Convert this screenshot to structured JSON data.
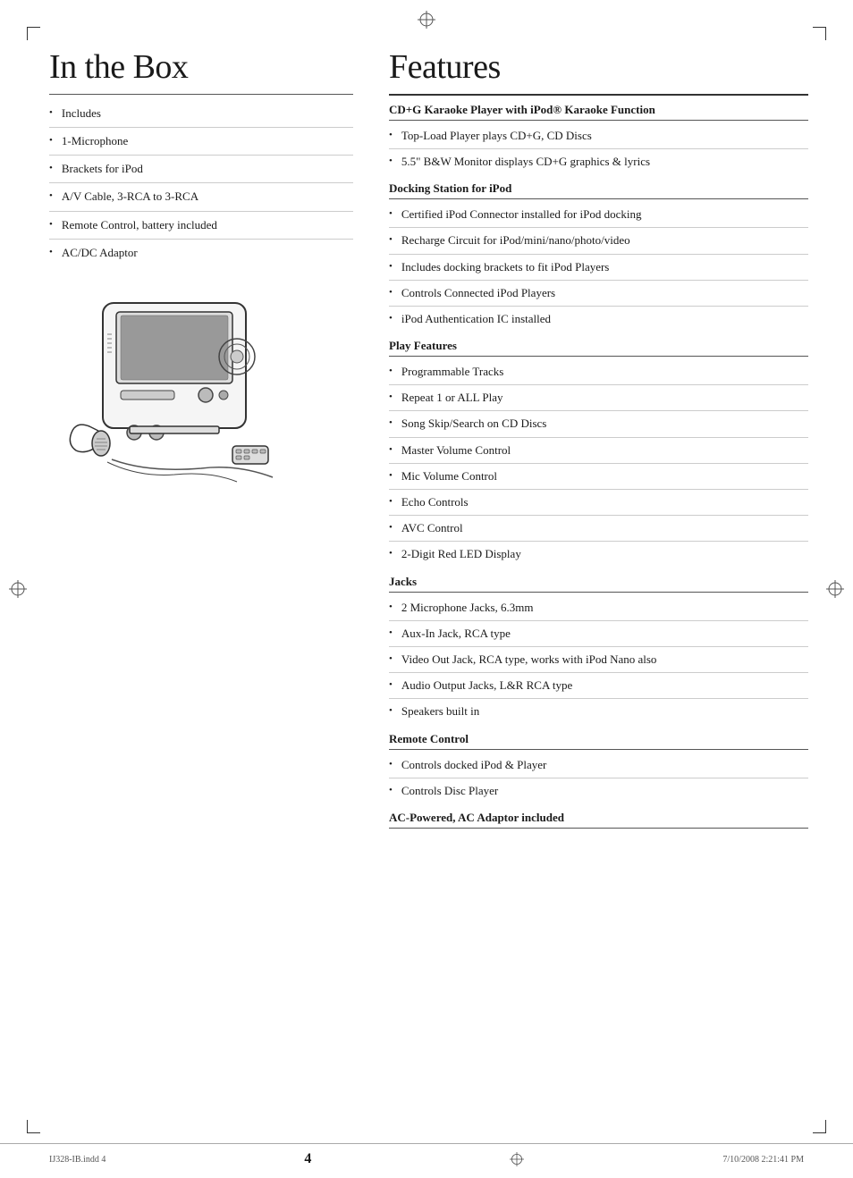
{
  "page": {
    "number": "4",
    "footer_left": "IJ328-IB.indd   4",
    "footer_right": "7/10/2008   2:21:41 PM"
  },
  "left": {
    "title": "In the Box",
    "items": [
      "Includes",
      "1-Microphone",
      "Brackets for iPod",
      "A/V Cable, 3-RCA to 3-RCA",
      "Remote Control, battery included",
      "AC/DC Adaptor"
    ]
  },
  "right": {
    "title": "Features",
    "sections": [
      {
        "header": "CD+G Karaoke Player with iPod® Karaoke Function",
        "items": [
          "Top-Load Player plays CD+G, CD Discs",
          "5.5\" B&W Monitor displays CD+G graphics & lyrics"
        ]
      },
      {
        "header": "Docking Station for iPod",
        "items": [
          "Certified iPod Connector installed for iPod docking",
          "Recharge Circuit for iPod/mini/nano/photo/video",
          "Includes docking brackets to fit iPod Players",
          "Controls Connected iPod Players",
          "iPod Authentication IC installed"
        ]
      },
      {
        "header": "Play Features",
        "items": [
          "Programmable Tracks",
          "Repeat 1 or ALL Play",
          "Song Skip/Search on CD Discs",
          "Master Volume Control",
          "Mic Volume Control",
          "Echo Controls",
          "AVC Control",
          "2-Digit Red LED Display"
        ]
      },
      {
        "header": "Jacks",
        "items": [
          "2 Microphone Jacks, 6.3mm",
          "Aux-In Jack, RCA type",
          "Video Out Jack, RCA type, works with iPod Nano also",
          "Audio Output Jacks, L&R RCA type",
          "Speakers built in"
        ]
      },
      {
        "header": "Remote Control",
        "items": [
          "Controls docked iPod & Player",
          "Controls Disc Player"
        ]
      },
      {
        "header": "AC-Powered, AC Adaptor included",
        "items": []
      }
    ]
  }
}
